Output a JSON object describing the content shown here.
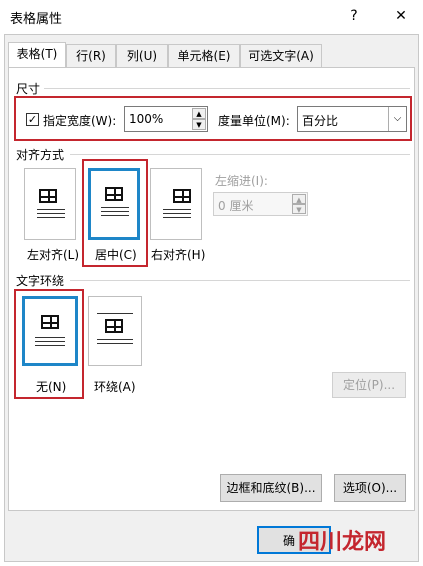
{
  "window": {
    "title": "表格属性",
    "help": "?",
    "close": "✕"
  },
  "tabs": [
    {
      "label": "表格(T)"
    },
    {
      "label": "行(R)"
    },
    {
      "label": "列(U)"
    },
    {
      "label": "单元格(E)"
    },
    {
      "label": "可选文字(A)"
    }
  ],
  "size": {
    "group_label": "尺寸",
    "preferred_width_label": "指定宽度(W):",
    "preferred_width_checked": true,
    "width_value": "100%",
    "measure_label": "度量单位(M):",
    "measure_value": "百分比"
  },
  "alignment": {
    "group_label": "对齐方式",
    "options": [
      {
        "label": "左对齐(L)"
      },
      {
        "label": "居中(C)"
      },
      {
        "label": "右对齐(H)"
      }
    ],
    "selected": "居中(C)",
    "indent_label": "左缩进(I):",
    "indent_value": "0 厘米"
  },
  "wrapping": {
    "group_label": "文字环绕",
    "options": [
      {
        "label": "无(N)"
      },
      {
        "label": "环绕(A)"
      }
    ],
    "selected": "无(N)",
    "position_button": "定位(P)..."
  },
  "footer": {
    "borders_button": "边框和底纹(B)...",
    "options_button": "选项(O)...",
    "ok_button": "确",
    "watermark": "四川龙网"
  }
}
